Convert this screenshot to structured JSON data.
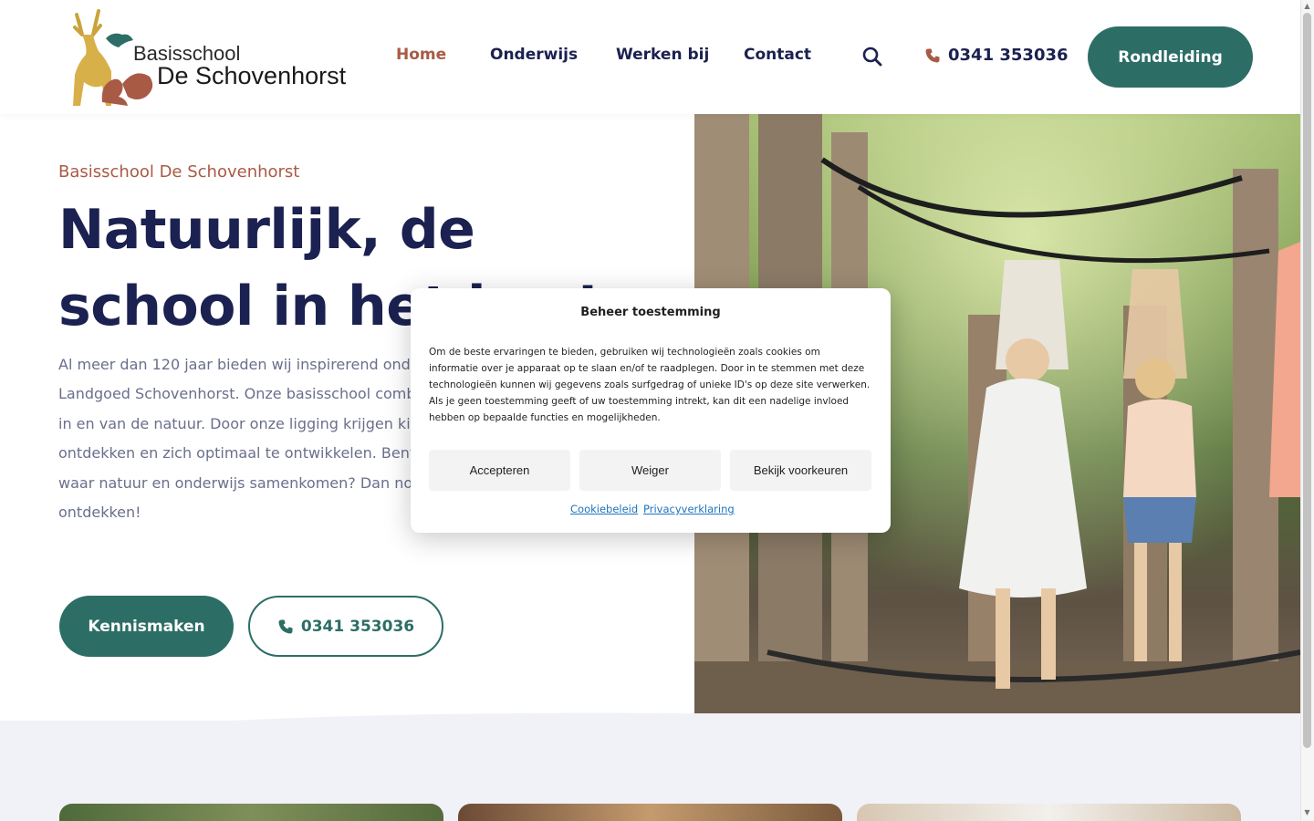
{
  "header": {
    "logo": {
      "line1": "Basisschool",
      "line2": "De Schovenhorst"
    },
    "nav": [
      {
        "label": "Home",
        "active": true
      },
      {
        "label": "Onderwijs",
        "active": false
      },
      {
        "label": "Werken bij",
        "active": false
      },
      {
        "label": "Contact",
        "active": false
      }
    ],
    "search_icon": "search-icon",
    "phone": "0341 353036",
    "cta": "Rondleiding"
  },
  "hero": {
    "eyebrow": "Basisschool De Schovenhorst",
    "title": "Natuurlijk, de school in het bos!",
    "text": "Al meer dan 120 jaar bieden wij inspirerend onderwijs in de groene omgeving van Landgoed Schovenhorst. Onze basisschool combineert sterk onderwijs met leren in en van de natuur. Door onze ligging krijgen kinderen de kans om buiten te ontdekken en zich optimaal te ontwikkelen. Bent u op zoek naar een basisschool waar natuur en onderwijs samenkomen? Dan nodigen wij u uit om onze school te ontdekken!",
    "primary_button": "Kennismaken",
    "phone_button": "0341 353036"
  },
  "consent": {
    "title": "Beheer toestemming",
    "body": "Om de beste ervaringen te bieden, gebruiken wij technologieën zoals cookies om informatie over je apparaat op te slaan en/of te raadplegen. Door in te stemmen met deze technologieën kunnen wij gegevens zoals surfgedrag of unieke ID's op deze site verwerken. Als je geen toestemming geeft of uw toestemming intrekt, kan dit een nadelige invloed hebben op bepaalde functies en mogelijkheden.",
    "accept": "Accepteren",
    "deny": "Weiger",
    "preferences": "Bekijk voorkeuren",
    "link_cookie": "Cookiebeleid",
    "link_privacy": "Privacyverklaring"
  },
  "colors": {
    "brand_green": "#2c6e66",
    "navy": "#1b2150",
    "rust": "#a95a45",
    "body_grey": "#6a6f8c"
  }
}
